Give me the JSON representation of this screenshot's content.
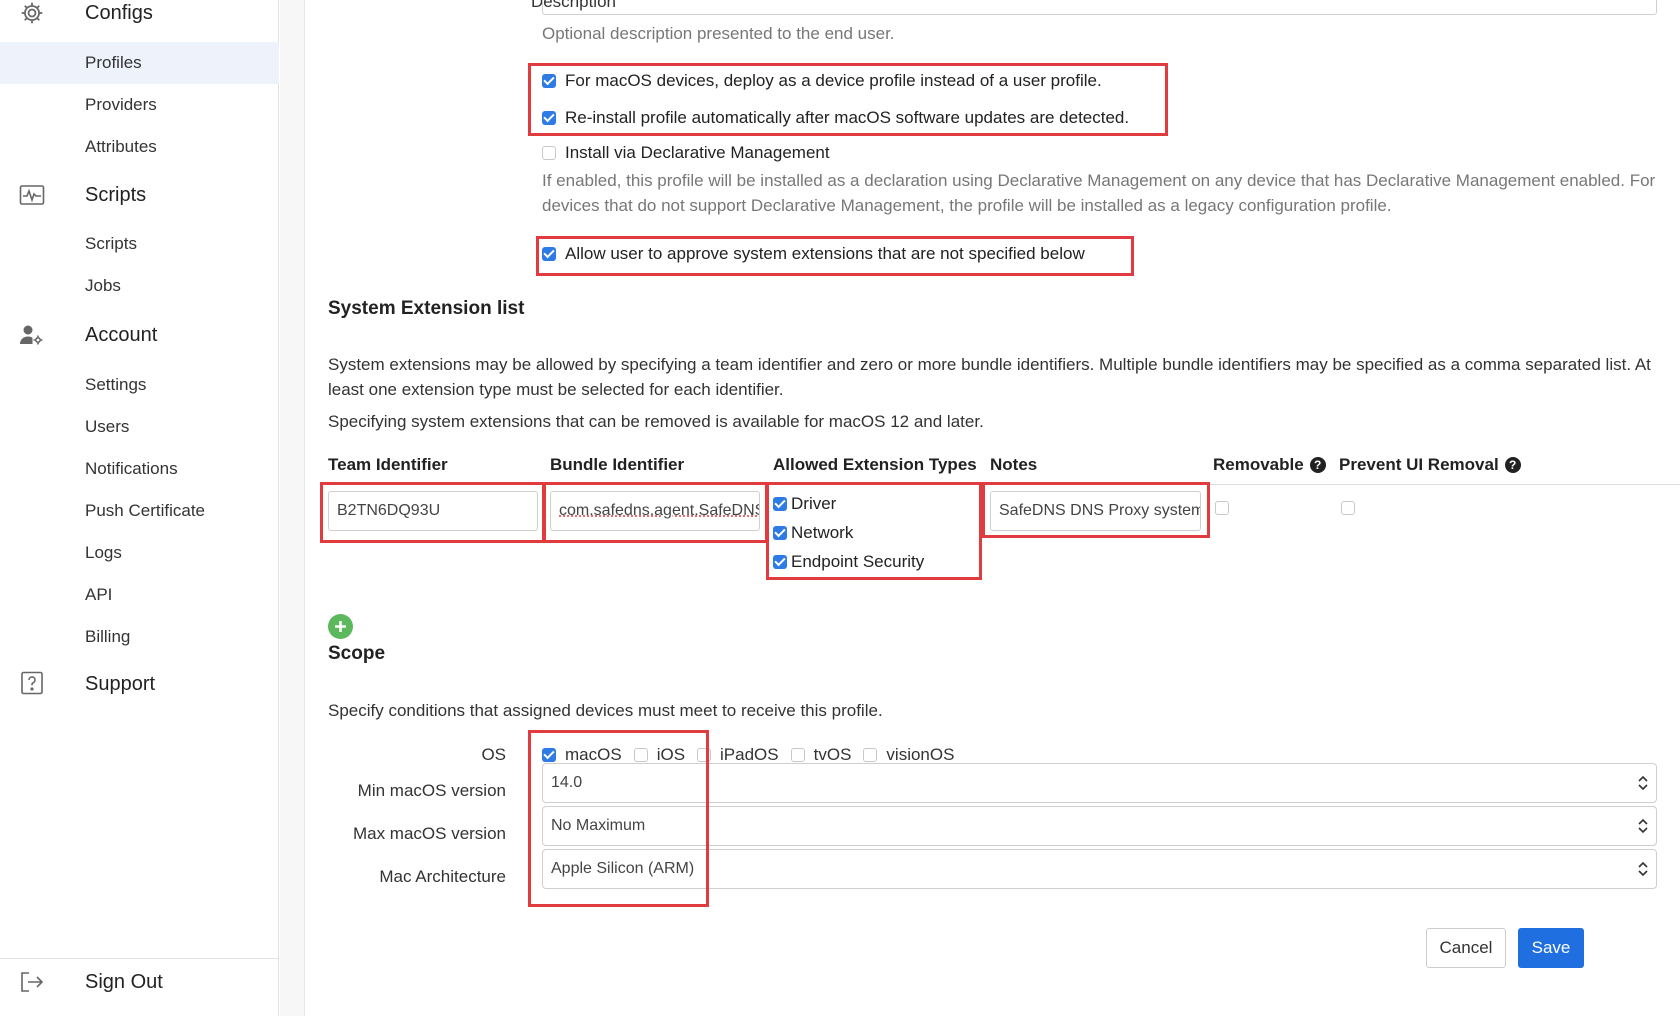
{
  "sidebar": {
    "sections": [
      {
        "label": "Configs",
        "icon": "gear-icon"
      },
      {
        "label": "Scripts",
        "icon": "script-icon"
      },
      {
        "label": "Account",
        "icon": "user-cog-icon"
      },
      {
        "label": "Support",
        "icon": "question-icon"
      }
    ],
    "configs_items": [
      "Profiles",
      "Providers",
      "Attributes"
    ],
    "scripts_items": [
      "Scripts",
      "Jobs"
    ],
    "account_items": [
      "Settings",
      "Users",
      "Notifications",
      "Push Certificate",
      "Logs",
      "API",
      "Billing"
    ],
    "sign_out": "Sign Out",
    "active_item": "Profiles"
  },
  "form": {
    "description_label": "Description",
    "description_hint": "Optional description presented to the end user.",
    "deploy_device_profile": {
      "label": "For macOS devices, deploy as a device profile instead of a user profile.",
      "checked": true
    },
    "reinstall_after_updates": {
      "label": "Re-install profile automatically after macOS software updates are detected.",
      "checked": true
    },
    "declarative_management": {
      "label": "Install via Declarative Management",
      "checked": false
    },
    "declarative_hint": "If enabled, this profile will be installed as a declaration using Declarative Management on any device that has Declarative Management enabled. For devices that do not support Declarative Management, the profile will be installed as a legacy configuration profile.",
    "allow_user_approve": {
      "label": "Allow user to approve system extensions that are not specified below",
      "checked": true
    }
  },
  "extension_list": {
    "title": "System Extension list",
    "desc1": "System extensions may be allowed by specifying a team identifier and zero or more bundle identifiers. Multiple bundle identifiers may be specified as a comma separated list. At least one extension type must be selected for each identifier.",
    "desc2": "Specifying system extensions that can be removed is available for macOS 12 and later.",
    "columns": {
      "team": "Team Identifier",
      "bundle": "Bundle Identifier",
      "types": "Allowed Extension Types",
      "notes": "Notes",
      "removable": "Removable",
      "prevent_ui": "Prevent UI Removal"
    },
    "row": {
      "team_id": "B2TN6DQ93U",
      "bundle_id": "com.safedns.agent.SafeDNS",
      "types": [
        {
          "label": "Driver",
          "checked": true
        },
        {
          "label": "Network",
          "checked": true
        },
        {
          "label": "Endpoint Security",
          "checked": true
        }
      ],
      "notes": "SafeDNS DNS Proxy system extension",
      "removable": false,
      "prevent_ui_removal": false
    }
  },
  "scope": {
    "title": "Scope",
    "desc": "Specify conditions that assigned devices must meet to receive this profile.",
    "os_label": "OS",
    "os_options": [
      {
        "label": "macOS",
        "checked": true
      },
      {
        "label": "iOS",
        "checked": false
      },
      {
        "label": "iPadOS",
        "checked": false
      },
      {
        "label": "tvOS",
        "checked": false
      },
      {
        "label": "visionOS",
        "checked": false
      }
    ],
    "min_label": "Min macOS version",
    "min_value": "14.0",
    "max_label": "Max macOS version",
    "max_value": "No Maximum",
    "arch_label": "Mac Architecture",
    "arch_value": "Apple Silicon (ARM)"
  },
  "buttons": {
    "cancel": "Cancel",
    "save": "Save"
  },
  "colors": {
    "accent": "#1f6fe0",
    "highlight": "#e03c40",
    "add": "#5cb85c"
  }
}
